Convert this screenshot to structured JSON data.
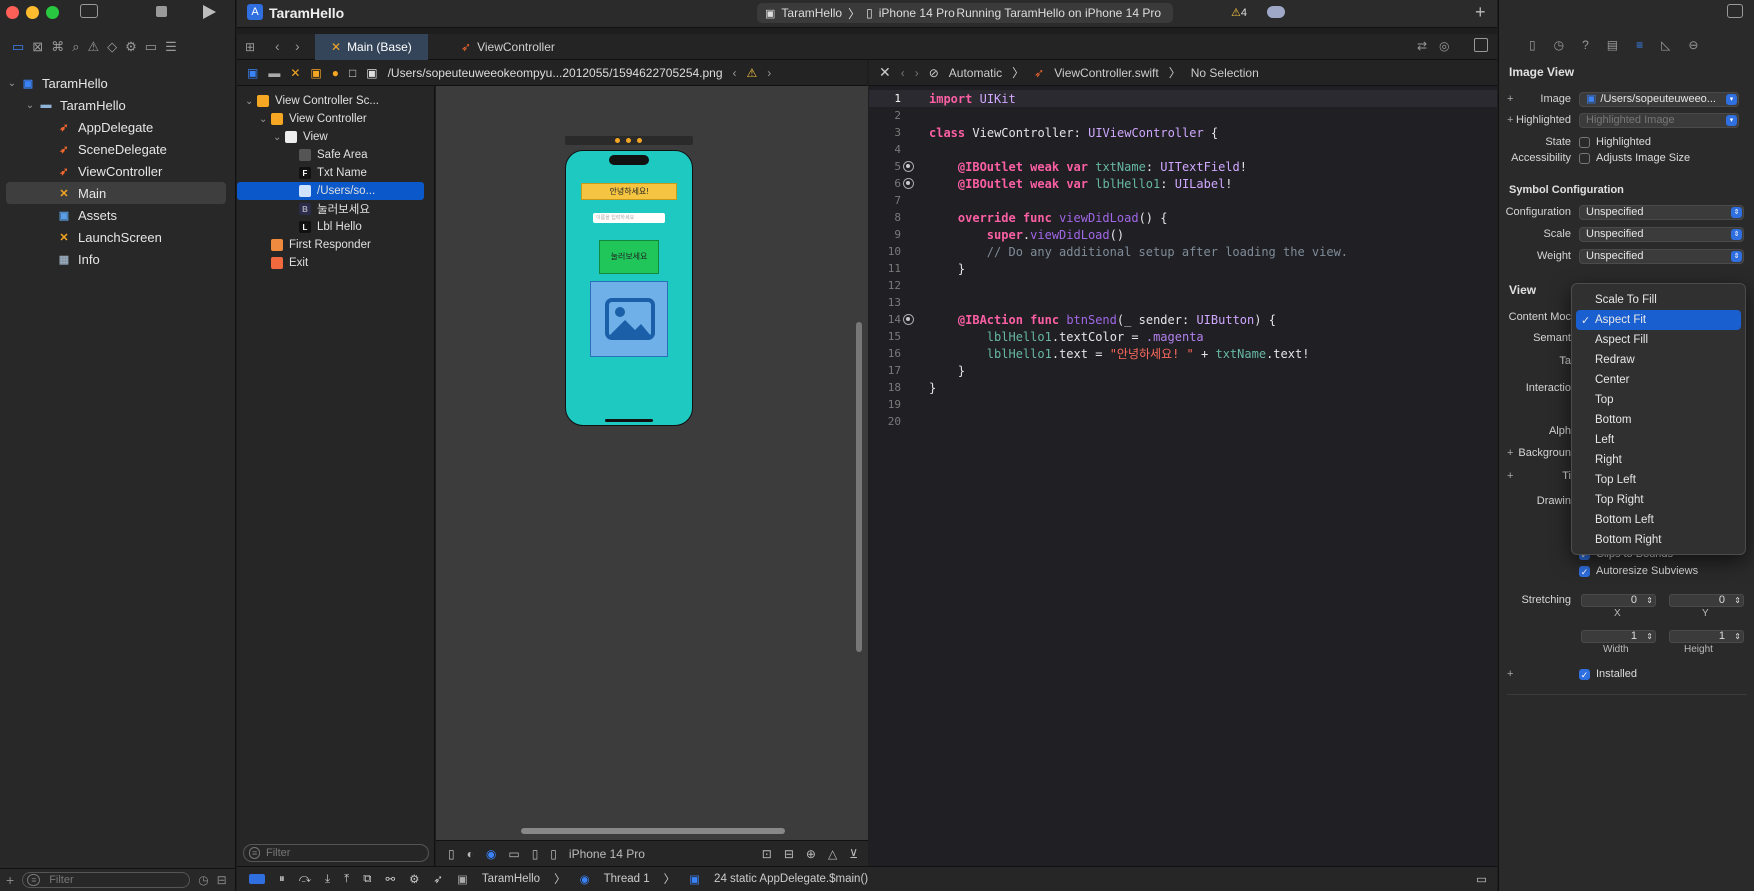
{
  "app": {
    "project_name": "TaramHello",
    "scheme_target": "TaramHello",
    "device": "iPhone 14 Pro",
    "status": "Running TaramHello on iPhone 14 Pro",
    "warnings": "4"
  },
  "navigator": {
    "items": [
      {
        "label": "TaramHello",
        "indent": 0,
        "icon": "project-icon"
      },
      {
        "label": "TaramHello",
        "indent": 1,
        "icon": "folder-icon"
      },
      {
        "label": "AppDelegate",
        "indent": 2,
        "icon": "swift-icon"
      },
      {
        "label": "SceneDelegate",
        "indent": 2,
        "icon": "swift-icon"
      },
      {
        "label": "ViewController",
        "indent": 2,
        "icon": "swift-icon"
      },
      {
        "label": "Main",
        "indent": 2,
        "icon": "storyboard-icon",
        "selected": true
      },
      {
        "label": "Assets",
        "indent": 2,
        "icon": "assets-icon"
      },
      {
        "label": "LaunchScreen",
        "indent": 2,
        "icon": "storyboard-icon"
      },
      {
        "label": "Info",
        "indent": 2,
        "icon": "plist-icon"
      }
    ],
    "filter_placeholder": "Filter"
  },
  "tabs": [
    {
      "label": "Main (Base)",
      "active": true
    },
    {
      "label": "ViewController",
      "active": false
    }
  ],
  "jumpbar": {
    "path": "/Users/sopeuteuweeokeompyu...2012055/1594622705254.png"
  },
  "outline": {
    "items": [
      {
        "label": "View Controller Sc...",
        "indent": 0,
        "badge": "scene-icon"
      },
      {
        "label": "View Controller",
        "indent": 1,
        "badge": "vc-icon"
      },
      {
        "label": "View",
        "indent": 2,
        "badge": "view-icon"
      },
      {
        "label": "Safe Area",
        "indent": 3,
        "badge": "safe-area-icon"
      },
      {
        "label": "Txt Name",
        "indent": 3,
        "badge": "textfield-icon",
        "mark": "F"
      },
      {
        "label": "/Users/so...",
        "indent": 3,
        "badge": "imageview-icon",
        "selected": true
      },
      {
        "label": "눌러보세요",
        "indent": 3,
        "badge": "button-icon",
        "mark": "B"
      },
      {
        "label": "Lbl Hello",
        "indent": 3,
        "badge": "label-icon",
        "mark": "L"
      },
      {
        "label": "First Responder",
        "indent": 1,
        "badge": "first-responder-icon"
      },
      {
        "label": "Exit",
        "indent": 1,
        "badge": "exit-icon"
      }
    ],
    "filter_placeholder": "Filter"
  },
  "canvas": {
    "label_text": "안녕하세요!",
    "textfield_placeholder": "이름을 입력하세요",
    "button_text": "눌러보세요",
    "footer_device": "iPhone 14 Pro"
  },
  "editor": {
    "mode": "Automatic",
    "file": "ViewController.swift",
    "selection": "No Selection",
    "lines": [
      {
        "n": "1",
        "text": "import UIKit"
      },
      {
        "n": "2",
        "text": ""
      },
      {
        "n": "3",
        "text": "class ViewController: UIViewController {"
      },
      {
        "n": "4",
        "text": ""
      },
      {
        "n": "5",
        "text": "    @IBOutlet weak var txtName: UITextField!",
        "dot": true
      },
      {
        "n": "6",
        "text": "    @IBOutlet weak var lblHello1: UILabel!",
        "dot": true
      },
      {
        "n": "7",
        "text": ""
      },
      {
        "n": "8",
        "text": "    override func viewDidLoad() {"
      },
      {
        "n": "9",
        "text": "        super.viewDidLoad()"
      },
      {
        "n": "10",
        "text": "        // Do any additional setup after loading the view."
      },
      {
        "n": "11",
        "text": "    }"
      },
      {
        "n": "12",
        "text": ""
      },
      {
        "n": "13",
        "text": ""
      },
      {
        "n": "14",
        "text": "    @IBAction func btnSend(_ sender: UIButton) {",
        "dot": true
      },
      {
        "n": "15",
        "text": "        lblHello1.textColor = .magenta"
      },
      {
        "n": "16",
        "text": "        lblHello1.text = \"안녕하세요! \" + txtName.text!"
      },
      {
        "n": "17",
        "text": "    }"
      },
      {
        "n": "18",
        "text": "}"
      },
      {
        "n": "19",
        "text": ""
      },
      {
        "n": "20",
        "text": ""
      }
    ]
  },
  "inspector": {
    "section_title": "Image View",
    "image_label": "Image",
    "image_value": "/Users/sopeuteuweeo...",
    "highlighted_label": "Highlighted",
    "highlighted_placeholder": "Highlighted Image",
    "state_label": "State",
    "state_value": "Highlighted",
    "accessibility_label": "Accessibility",
    "accessibility_value": "Adjusts Image Size",
    "symbol_title": "Symbol Configuration",
    "configuration_label": "Configuration",
    "configuration_value": "Unspecified",
    "scale_label": "Scale",
    "scale_value": "Unspecified",
    "weight_label": "Weight",
    "weight_value": "Unspecified",
    "view_title": "View",
    "content_mode_label": "Content Moc",
    "semantic_label": "Semant",
    "tag_label": "Ta",
    "interaction_label": "Interactio",
    "alpha_label": "Alph",
    "background_label": "Backgroun",
    "tint_label": "Ti",
    "drawing_label": "Drawin",
    "clips_label": "Clips to Bounds",
    "autoresize_label": "Autoresize Subviews",
    "stretching_label": "Stretching",
    "stretch_x": "0",
    "stretch_y": "0",
    "x_label": "X",
    "y_label": "Y",
    "stretch_w": "1",
    "stretch_h": "1",
    "width_label": "Width",
    "height_label": "Height",
    "installed_label": "Installed"
  },
  "content_mode_menu": {
    "options": [
      {
        "label": "Scale To Fill"
      },
      {
        "label": "Aspect Fit",
        "checked": true
      },
      {
        "label": "Aspect Fill"
      },
      {
        "label": "Redraw"
      },
      {
        "label": "Center"
      },
      {
        "label": "Top"
      },
      {
        "label": "Bottom"
      },
      {
        "label": "Left"
      },
      {
        "label": "Right"
      },
      {
        "label": "Top Left"
      },
      {
        "label": "Top Right"
      },
      {
        "label": "Bottom Left"
      },
      {
        "label": "Bottom Right"
      }
    ]
  },
  "debug": {
    "target": "TaramHello",
    "thread": "Thread 1",
    "frame": "24 static AppDelegate.$main()"
  },
  "colors": {
    "accent": "#2f6fe0",
    "selection": "#0a58ca",
    "phone_bg": "#1ec9c1",
    "label_bg": "#f5c542",
    "button_bg": "#20c65a"
  }
}
